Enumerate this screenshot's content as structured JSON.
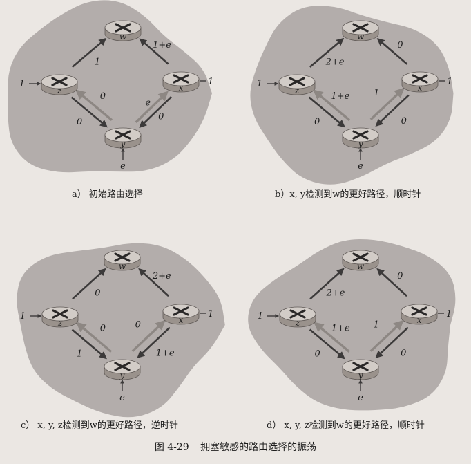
{
  "colors": {
    "background": "#ebe7e3",
    "blob": "#b3adab",
    "router_top": "#d2ccc7",
    "router_side": "#9a928c",
    "arrow_dark": "#3c3a3a",
    "arrow_light": "#8d8783",
    "text": "#1e1e1e"
  },
  "figure": {
    "number": "图 4-29",
    "title": "拥塞敏感的路由选择的振荡"
  },
  "panels": [
    {
      "caption": "a） 初始路由选择",
      "routers": [
        {
          "id": "w",
          "label": "w"
        },
        {
          "id": "z",
          "label": "z"
        },
        {
          "id": "x",
          "label": "x"
        },
        {
          "id": "y",
          "label": "y"
        }
      ],
      "inputs": {
        "z": "1",
        "x": "1",
        "y": "e"
      },
      "links": [
        {
          "edge": "zw",
          "label": "1"
        },
        {
          "edge": "xw",
          "label": "1+e"
        },
        {
          "edge": "yz",
          "upper": "0",
          "lower": "0"
        },
        {
          "edge": "yx",
          "label": "e"
        }
      ]
    },
    {
      "caption": "b）x, y检测到w的更好路径，顺时针",
      "routers": [
        {
          "id": "w",
          "label": "w"
        },
        {
          "id": "z",
          "label": "z"
        },
        {
          "id": "x",
          "label": "x"
        },
        {
          "id": "y",
          "label": "y"
        }
      ],
      "inputs": {
        "z": "1",
        "x": "1",
        "y": "e"
      },
      "links": [
        {
          "edge": "zw",
          "label": "2+e"
        },
        {
          "edge": "xw",
          "label": "0"
        },
        {
          "edge": "yz",
          "upper": "1+e",
          "lower": "0"
        },
        {
          "edge": "yx",
          "upper": "1",
          "lower": "0"
        }
      ]
    },
    {
      "caption": "c） x, y, z检测到w的更好路径，逆时针",
      "routers": [
        {
          "id": "w",
          "label": "w"
        },
        {
          "id": "z",
          "label": "z"
        },
        {
          "id": "x",
          "label": "x"
        },
        {
          "id": "y",
          "label": "y"
        }
      ],
      "inputs": {
        "z": "1",
        "x": "1",
        "y": "e"
      },
      "links": [
        {
          "edge": "zw",
          "label": "0"
        },
        {
          "edge": "xw",
          "label": "2+e"
        },
        {
          "edge": "yz",
          "upper": "0",
          "lower": "1"
        },
        {
          "edge": "yx",
          "upper": "0",
          "lower": "1+e"
        }
      ]
    },
    {
      "caption": "d） x, y, z检测到w的更好路径，顺时针",
      "routers": [
        {
          "id": "w",
          "label": "w"
        },
        {
          "id": "z",
          "label": "z"
        },
        {
          "id": "x",
          "label": "x"
        },
        {
          "id": "y",
          "label": "y"
        }
      ],
      "inputs": {
        "z": "1",
        "x": "1",
        "y": "e"
      },
      "links": [
        {
          "edge": "zw",
          "label": "2+e"
        },
        {
          "edge": "xw",
          "label": "0"
        },
        {
          "edge": "yz",
          "upper": "1+e",
          "lower": "0"
        },
        {
          "edge": "yx",
          "upper": "1",
          "lower": "0"
        }
      ]
    }
  ]
}
